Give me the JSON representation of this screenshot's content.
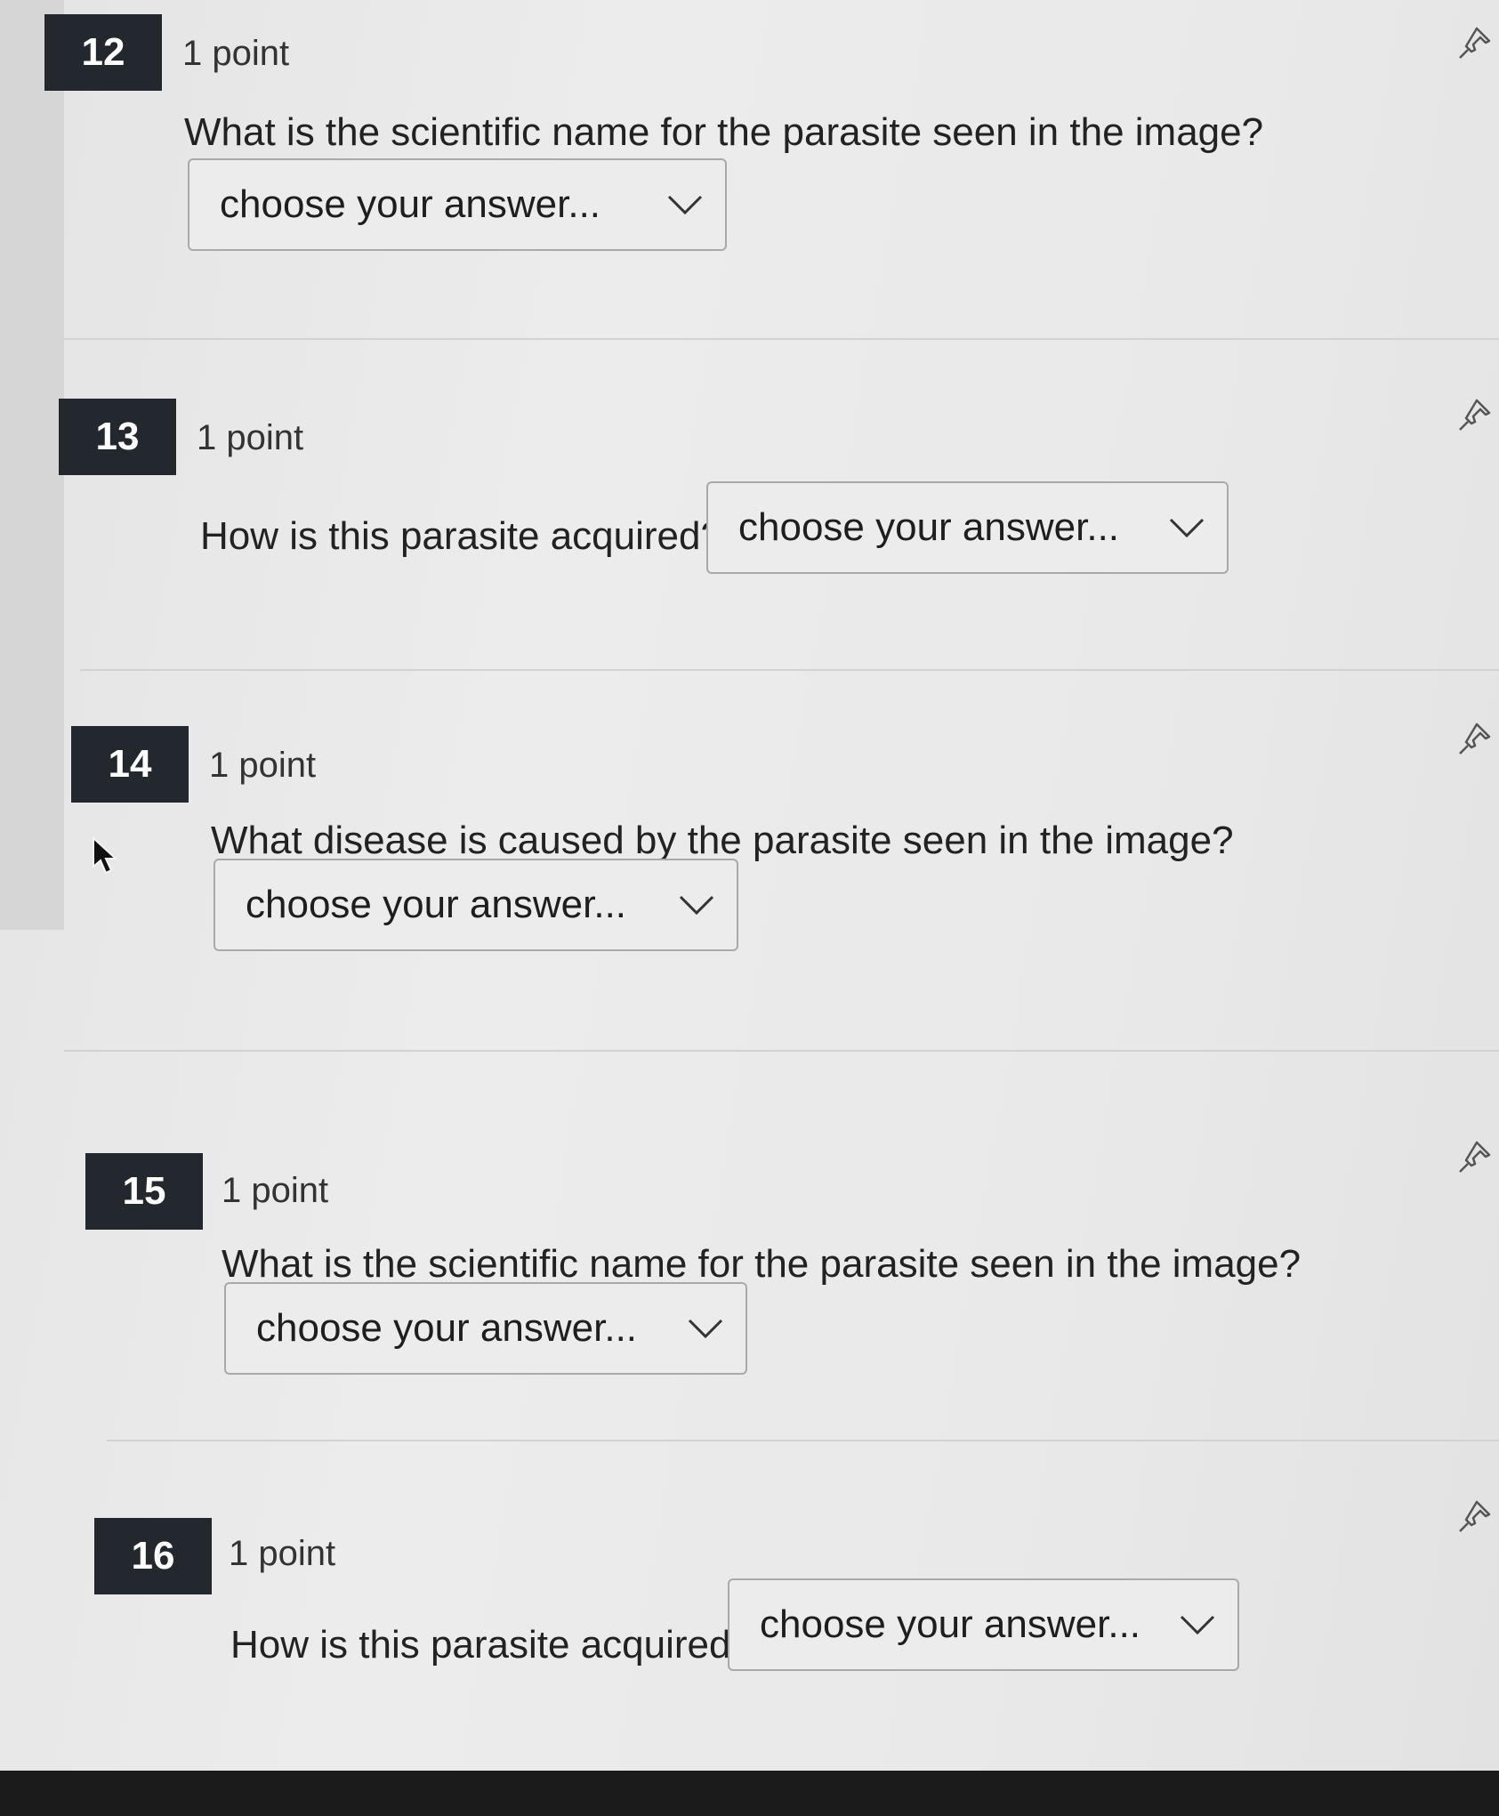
{
  "questions": [
    {
      "number": "12",
      "points": "1 point",
      "text": "What is the scientific name for the parasite seen in the image?",
      "select": "choose your answer..."
    },
    {
      "number": "13",
      "points": "1 point",
      "text": "How is this parasite acquired?",
      "select": "choose your answer..."
    },
    {
      "number": "14",
      "points": "1 point",
      "text": "What disease is caused by the parasite seen in the image?",
      "select": "choose your answer..."
    },
    {
      "number": "15",
      "points": "1 point",
      "text": "What is the scientific name for the parasite seen in the image?",
      "select": "choose your answer..."
    },
    {
      "number": "16",
      "points": "1 point",
      "text": "How is this parasite acquired?",
      "select": "choose your answer..."
    }
  ],
  "icons": {
    "pin": "pin-icon",
    "chevron": "chevron-down-icon",
    "cursor": "mouse-cursor-icon"
  },
  "colors": {
    "number_badge": "#22282e",
    "background": "#e8e8e8"
  }
}
